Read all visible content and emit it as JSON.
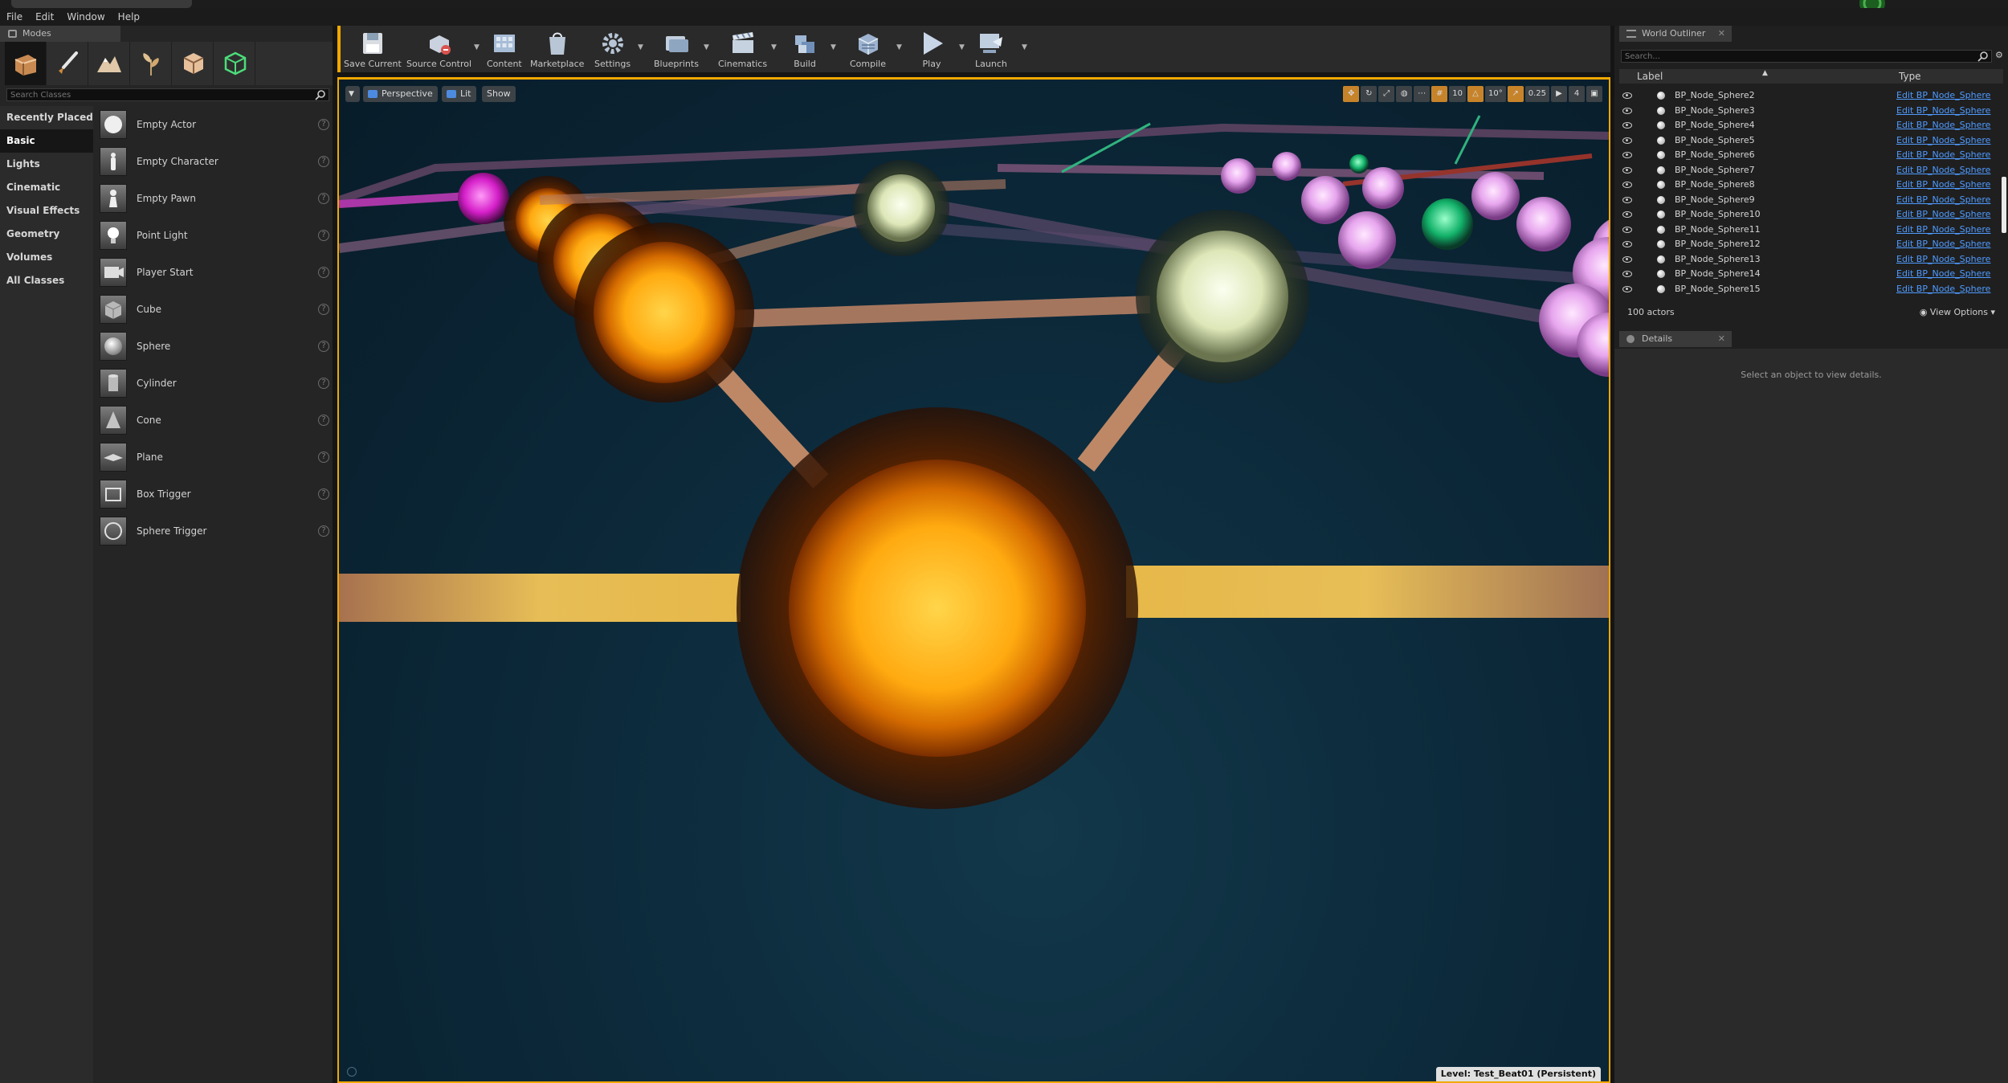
{
  "window": {
    "doc_tab": "",
    "network_label": ""
  },
  "menu": [
    "File",
    "Edit",
    "Window",
    "Help"
  ],
  "modes": {
    "tab_label": "Modes",
    "search_placeholder": "Search Classes",
    "mode_icons": [
      "place-mode-icon",
      "paint-mode-icon",
      "landscape-mode-icon",
      "foliage-mode-icon",
      "geometry-mode-icon",
      "mesh-paint-mode-icon"
    ],
    "categories": [
      "Recently Placed",
      "Basic",
      "Lights",
      "Cinematic",
      "Visual Effects",
      "Geometry",
      "Volumes",
      "All Classes"
    ],
    "active_category": "Basic",
    "classes": [
      {
        "name": "Empty Actor",
        "icon": "empty-actor-icon"
      },
      {
        "name": "Empty Character",
        "icon": "empty-character-icon"
      },
      {
        "name": "Empty Pawn",
        "icon": "empty-pawn-icon"
      },
      {
        "name": "Point Light",
        "icon": "point-light-icon"
      },
      {
        "name": "Player Start",
        "icon": "player-start-icon"
      },
      {
        "name": "Cube",
        "icon": "cube-icon"
      },
      {
        "name": "Sphere",
        "icon": "sphere-icon"
      },
      {
        "name": "Cylinder",
        "icon": "cylinder-icon"
      },
      {
        "name": "Cone",
        "icon": "cone-icon"
      },
      {
        "name": "Plane",
        "icon": "plane-icon"
      },
      {
        "name": "Box Trigger",
        "icon": "box-trigger-icon"
      },
      {
        "name": "Sphere Trigger",
        "icon": "sphere-trigger-icon"
      }
    ],
    "help_glyph": "?"
  },
  "toolbar": {
    "save_current": "Save Current",
    "source_control": "Source Control",
    "content": "Content",
    "marketplace": "Marketplace",
    "settings": "Settings",
    "blueprints": "Blueprints",
    "cinematics": "Cinematics",
    "build": "Build",
    "compile": "Compile",
    "play": "Play",
    "launch": "Launch",
    "accent": "#f2a800"
  },
  "viewport": {
    "perspective": "Perspective",
    "lit": "Lit",
    "show": "Show",
    "grid_snap": "10",
    "rotation_snap": "10°",
    "scale_snap": "0.25",
    "camera_speed": "4",
    "level": "Level:  Test_Beat01 (Persistent)"
  },
  "outliner": {
    "tab_label": "World Outliner",
    "search_placeholder": "Search...",
    "col_label": "Label",
    "col_type": "Type",
    "rows": [
      {
        "label": "BP_Node_Sphere2",
        "type": "Edit BP_Node_Sphere"
      },
      {
        "label": "BP_Node_Sphere3",
        "type": "Edit BP_Node_Sphere"
      },
      {
        "label": "BP_Node_Sphere4",
        "type": "Edit BP_Node_Sphere"
      },
      {
        "label": "BP_Node_Sphere5",
        "type": "Edit BP_Node_Sphere"
      },
      {
        "label": "BP_Node_Sphere6",
        "type": "Edit BP_Node_Sphere"
      },
      {
        "label": "BP_Node_Sphere7",
        "type": "Edit BP_Node_Sphere"
      },
      {
        "label": "BP_Node_Sphere8",
        "type": "Edit BP_Node_Sphere"
      },
      {
        "label": "BP_Node_Sphere9",
        "type": "Edit BP_Node_Sphere"
      },
      {
        "label": "BP_Node_Sphere10",
        "type": "Edit BP_Node_Sphere"
      },
      {
        "label": "BP_Node_Sphere11",
        "type": "Edit BP_Node_Sphere"
      },
      {
        "label": "BP_Node_Sphere12",
        "type": "Edit BP_Node_Sphere"
      },
      {
        "label": "BP_Node_Sphere13",
        "type": "Edit BP_Node_Sphere"
      },
      {
        "label": "BP_Node_Sphere14",
        "type": "Edit BP_Node_Sphere"
      },
      {
        "label": "BP_Node_Sphere15",
        "type": "Edit BP_Node_Sphere"
      }
    ],
    "actor_count": "100 actors",
    "view_options": "View Options"
  },
  "details": {
    "tab_label": "Details",
    "empty_message": "Select an object to view details."
  }
}
